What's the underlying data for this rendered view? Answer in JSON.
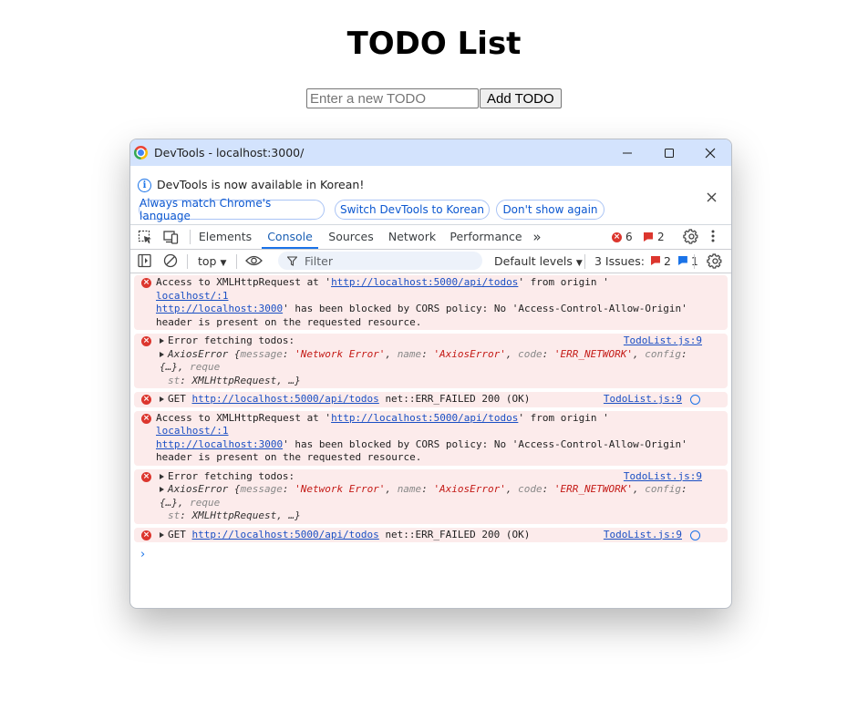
{
  "app": {
    "title": "TODO List",
    "input_placeholder": "Enter a new TODO",
    "add_button": "Add TODO"
  },
  "devtools": {
    "window_title": "DevTools - localhost:3000/",
    "infobar": {
      "message": "DevTools is now available in Korean!",
      "buttons": [
        "Always match Chrome's language",
        "Switch DevTools to Korean",
        "Don't show again"
      ]
    },
    "tabs": [
      "Elements",
      "Console",
      "Sources",
      "Network",
      "Performance"
    ],
    "active_tab": "Console",
    "error_count": "6",
    "warning_count": "2",
    "toolbar": {
      "context": "top",
      "filter_placeholder": "Filter",
      "levels": "Default levels",
      "issues_label": "3 Issues:",
      "issues_errors": "2",
      "issues_info": "1"
    },
    "messages": {
      "cors_1": {
        "pre": "Access to XMLHttpRequest at '",
        "url": "http://localhost:5000/api/todos",
        "mid": "' from origin '",
        "origin": "http://localhost:3000",
        "post": "' has been blocked by CORS policy: No 'Access-Control-Allow-Origin' header is present on the requested resource.",
        "source": "localhost/:1"
      },
      "err_1": {
        "text": "Error fetching todos:",
        "source": "TodoList.js:9",
        "obj_name": "AxiosError",
        "k_message": "message",
        "v_message": "'Network Error'",
        "k_name": "name",
        "v_name": "'AxiosError'",
        "k_code": "code",
        "v_code": "'ERR_NETWORK'",
        "k_config": "config",
        "v_config": "{…}",
        "k_request_1": "reque",
        "k_request_2": "st",
        "v_request": "XMLHttpRequest",
        "tail": "…}"
      },
      "get_1": {
        "method": "GET",
        "url": "http://localhost:5000/api/todos",
        "status": "net::ERR_FAILED 200 (OK)",
        "source": "TodoList.js:9"
      },
      "cors_2": {
        "pre": "Access to XMLHttpRequest at '",
        "url": "http://localhost:5000/api/todos",
        "mid": "' from origin '",
        "origin": "http://localhost:3000",
        "post": "' has been blocked by CORS policy: No 'Access-Control-Allow-Origin' header is present on the requested resource.",
        "source": "localhost/:1"
      },
      "err_2": {
        "text": "Error fetching todos:",
        "source": "TodoList.js:9",
        "obj_name": "AxiosError",
        "k_message": "message",
        "v_message": "'Network Error'",
        "k_name": "name",
        "v_name": "'AxiosError'",
        "k_code": "code",
        "v_code": "'ERR_NETWORK'",
        "k_config": "config",
        "v_config": "{…}",
        "k_request_1": "reque",
        "k_request_2": "st",
        "v_request": "XMLHttpRequest",
        "tail": "…}"
      },
      "get_2": {
        "method": "GET",
        "url": "http://localhost:5000/api/todos",
        "status": "net::ERR_FAILED 200 (OK)",
        "source": "TodoList.js:9"
      }
    },
    "colors": {
      "error": "#dc362e",
      "accent": "#1a73e8",
      "titlebar": "#d3e3fd",
      "error_row": "#fcebeb"
    }
  }
}
